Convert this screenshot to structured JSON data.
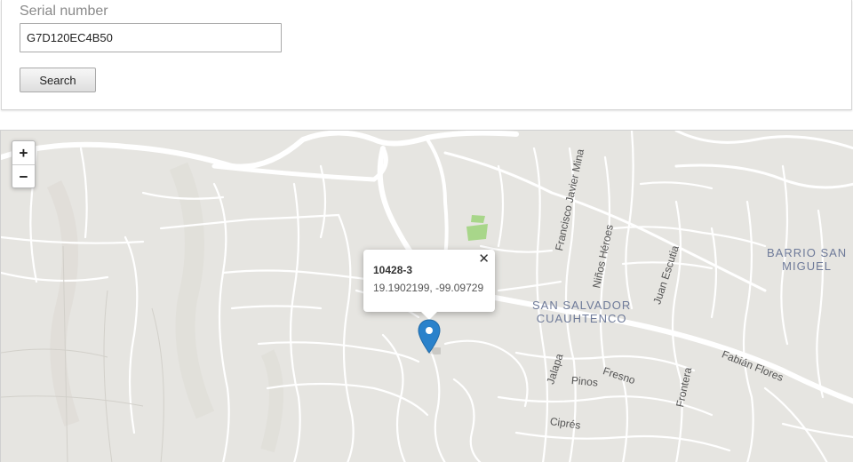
{
  "search": {
    "label": "Serial number",
    "value": "G7D120EC4B50",
    "button_label": "Search"
  },
  "map": {
    "zoom_in": "+",
    "zoom_out": "−",
    "districts": {
      "san_salvador": "SAN SALVADOR\nCUAUHTENCO",
      "barrio": "BARRIO SAN\nMIGUEL"
    },
    "streets": {
      "francisco": "Francisco Javier Mina",
      "ninos": "Niños Héroes",
      "juan": "Juan Escutia",
      "fabian": "Fabián Flores",
      "jalapa": "Jalapa",
      "fresno": "Fresno",
      "pinos": "Pinos",
      "frontera": "Frontera",
      "cipres": "Ciprés"
    },
    "popup": {
      "close": "✕",
      "title": "10428-3",
      "coords": "19.1902199, -99.09729"
    },
    "marker_color": "#2a82cb",
    "park_color": "#a8d68a"
  }
}
